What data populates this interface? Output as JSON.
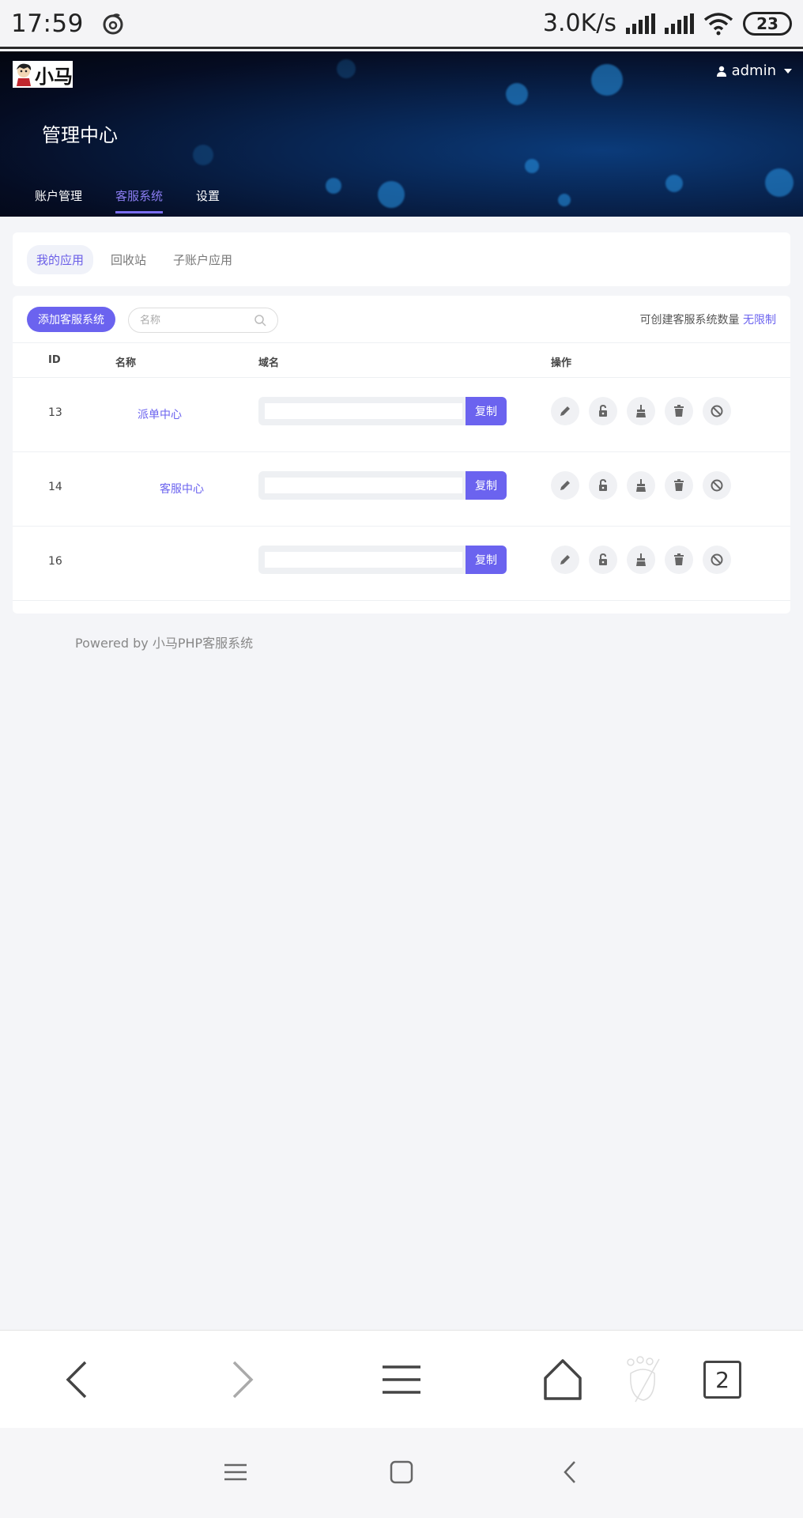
{
  "status_bar": {
    "time": "17:59",
    "network_speed": "3.0K/s",
    "battery": "23"
  },
  "header": {
    "logo_text": "小马",
    "user_name": "admin",
    "page_title": "管理中心",
    "nav": [
      {
        "label": "账户管理",
        "active": false
      },
      {
        "label": "客服系统",
        "active": true
      },
      {
        "label": "设置",
        "active": false
      }
    ]
  },
  "subtabs": [
    {
      "label": "我的应用",
      "active": true
    },
    {
      "label": "回收站",
      "active": false
    },
    {
      "label": "子账户应用",
      "active": false
    }
  ],
  "toolbar": {
    "add_button": "添加客服系统",
    "search_placeholder": "名称",
    "quota_label": "可创建客服系统数量",
    "quota_value": "无限制"
  },
  "table": {
    "headers": {
      "id": "ID",
      "name": "名称",
      "domain": "域名",
      "actions": "操作"
    },
    "copy_label": "复制",
    "rows": [
      {
        "id": "13",
        "name": "派单中心"
      },
      {
        "id": "14",
        "name": "客服中心"
      },
      {
        "id": "16",
        "name": ""
      }
    ],
    "actions": [
      "edit-icon",
      "unlock-icon",
      "clean-icon",
      "trash-icon",
      "disable-icon"
    ]
  },
  "footer": {
    "powered": "Powered by 小马PHP客服系统"
  },
  "browser": {
    "tab_count": "2"
  },
  "colors": {
    "accent": "#6b63ef",
    "banner_dark": "#050c22",
    "background": "#f4f5f8"
  }
}
